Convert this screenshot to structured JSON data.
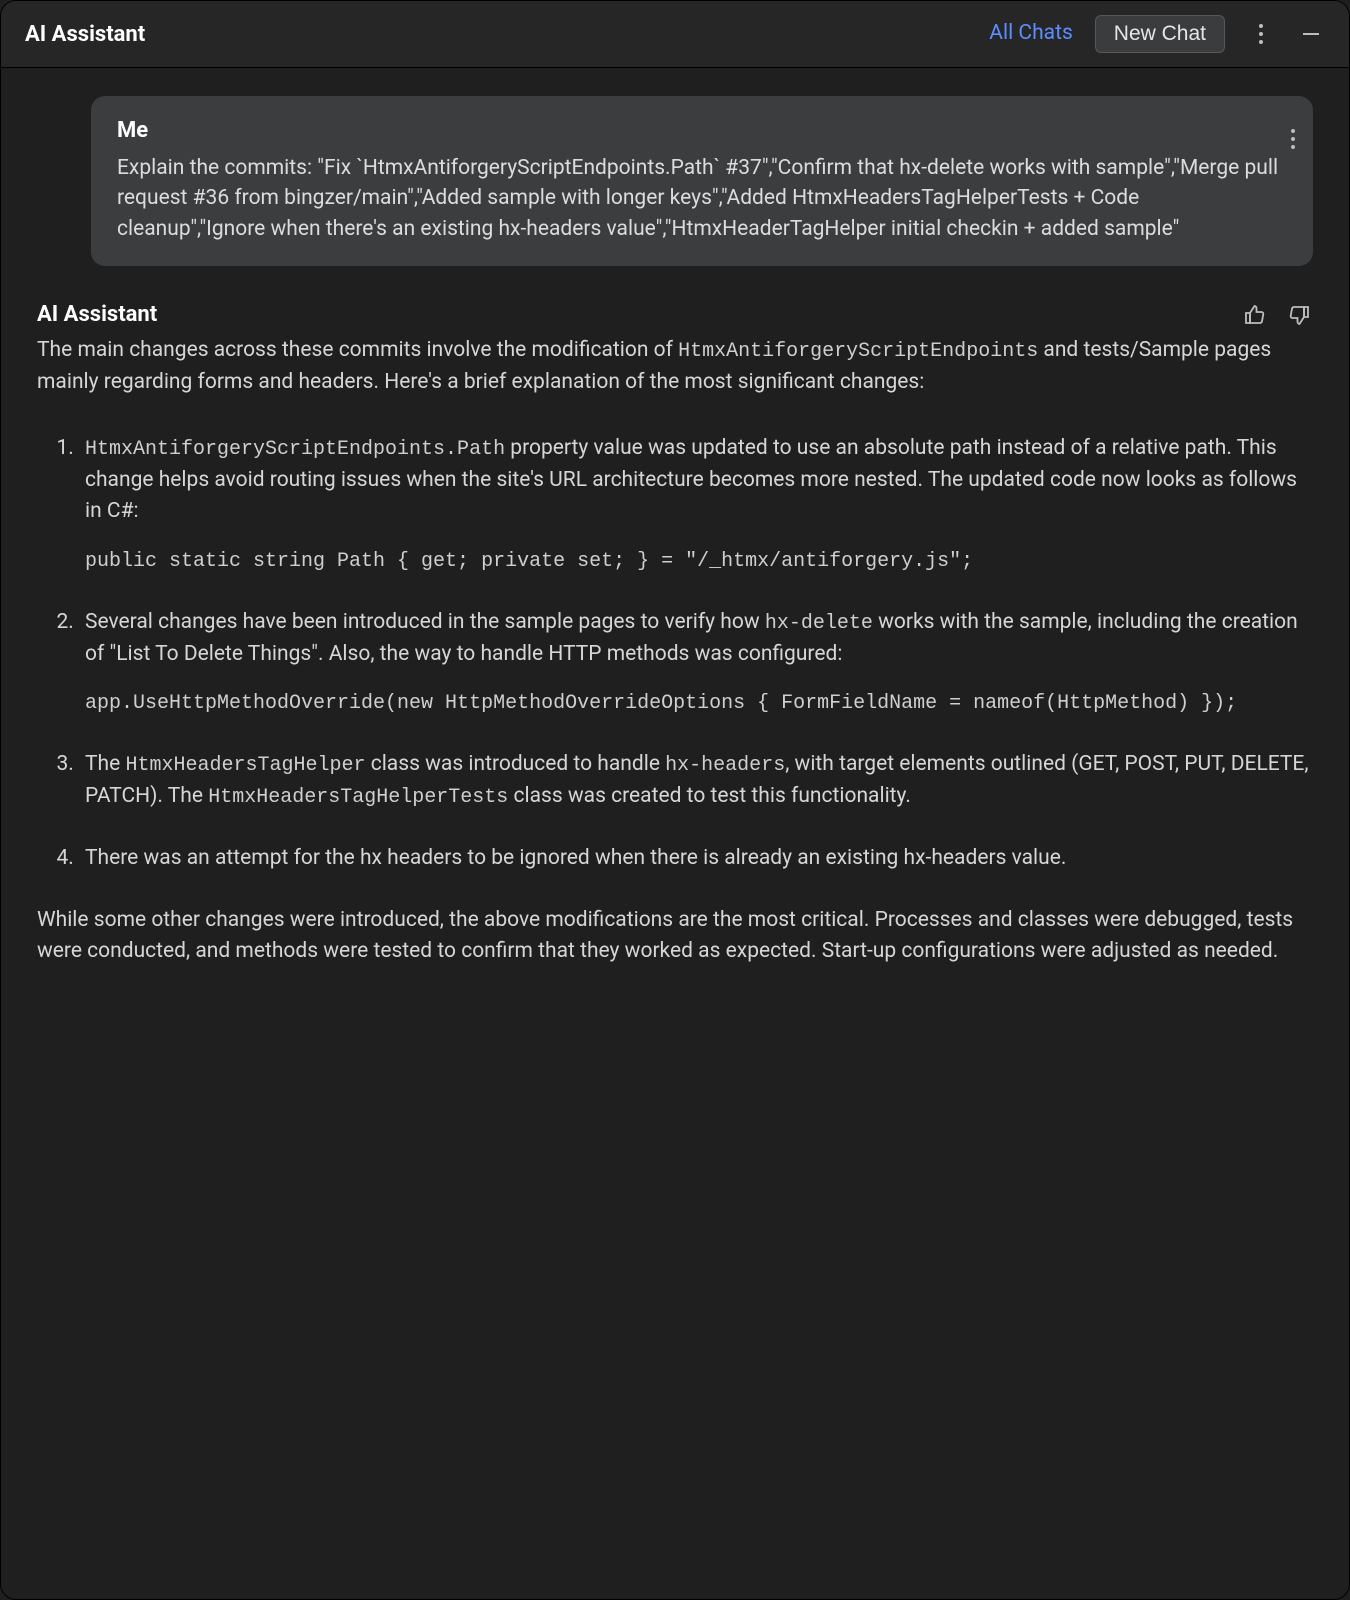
{
  "header": {
    "title": "AI Assistant",
    "all_chats": "All Chats",
    "new_chat": "New Chat"
  },
  "user": {
    "name": "Me",
    "message": "Explain the commits: \"Fix `HtmxAntiforgeryScriptEndpoints.Path` #37\",\"Confirm that hx-delete works with sample\",\"Merge pull request #36 from bingzer/main\",\"Added sample with longer keys\",\"Added HtmxHeadersTagHelperTests + Code cleanup\",\"Ignore when there's an existing hx-headers value\",\"HtmxHeaderTagHelper initial checkin + added sample\""
  },
  "assistant": {
    "name": "AI Assistant",
    "intro_pre": "The main changes across these commits involve the modification of ",
    "intro_code": "HtmxAntiforgeryScriptEndpoints",
    "intro_post": " and tests/Sample pages mainly regarding forms and headers. Here's a brief explanation of the most significant changes:",
    "items": [
      {
        "pre_code": "HtmxAntiforgeryScriptEndpoints.Path",
        "post": " property value was updated to use an absolute path instead of a relative path. This change helps avoid routing issues when the site's URL architecture becomes more nested. The updated code now looks as follows in C#:",
        "code": "public static string Path { get; private set; } = \"/_htmx/antiforgery.js\";"
      },
      {
        "pre": "Several changes have been introduced in the sample pages to verify how ",
        "mid_code": "hx-delete",
        "post": " works with the sample, including the creation of \"List To Delete Things\". Also, the way to handle HTTP methods was configured:",
        "code": "app.UseHttpMethodOverride(new HttpMethodOverrideOptions { FormFieldName = nameof(HttpMethod) });"
      },
      {
        "pre": "The ",
        "code1": "HtmxHeadersTagHelper",
        "mid1": " class was introduced to handle ",
        "code2": "hx-headers",
        "mid2": ", with target elements outlined (GET, POST, PUT, DELETE, PATCH). The ",
        "code3": "HtmxHeadersTagHelperTests",
        "post": " class was created to test this functionality."
      },
      {
        "text": "There was an attempt for the hx headers to be ignored when there is already an existing hx-headers value."
      }
    ],
    "outro": "While some other changes were introduced, the above modifications are the most critical. Processes and classes were debugged, tests were conducted, and methods were tested to confirm that they worked as expected. Start-up configurations were adjusted as needed."
  }
}
